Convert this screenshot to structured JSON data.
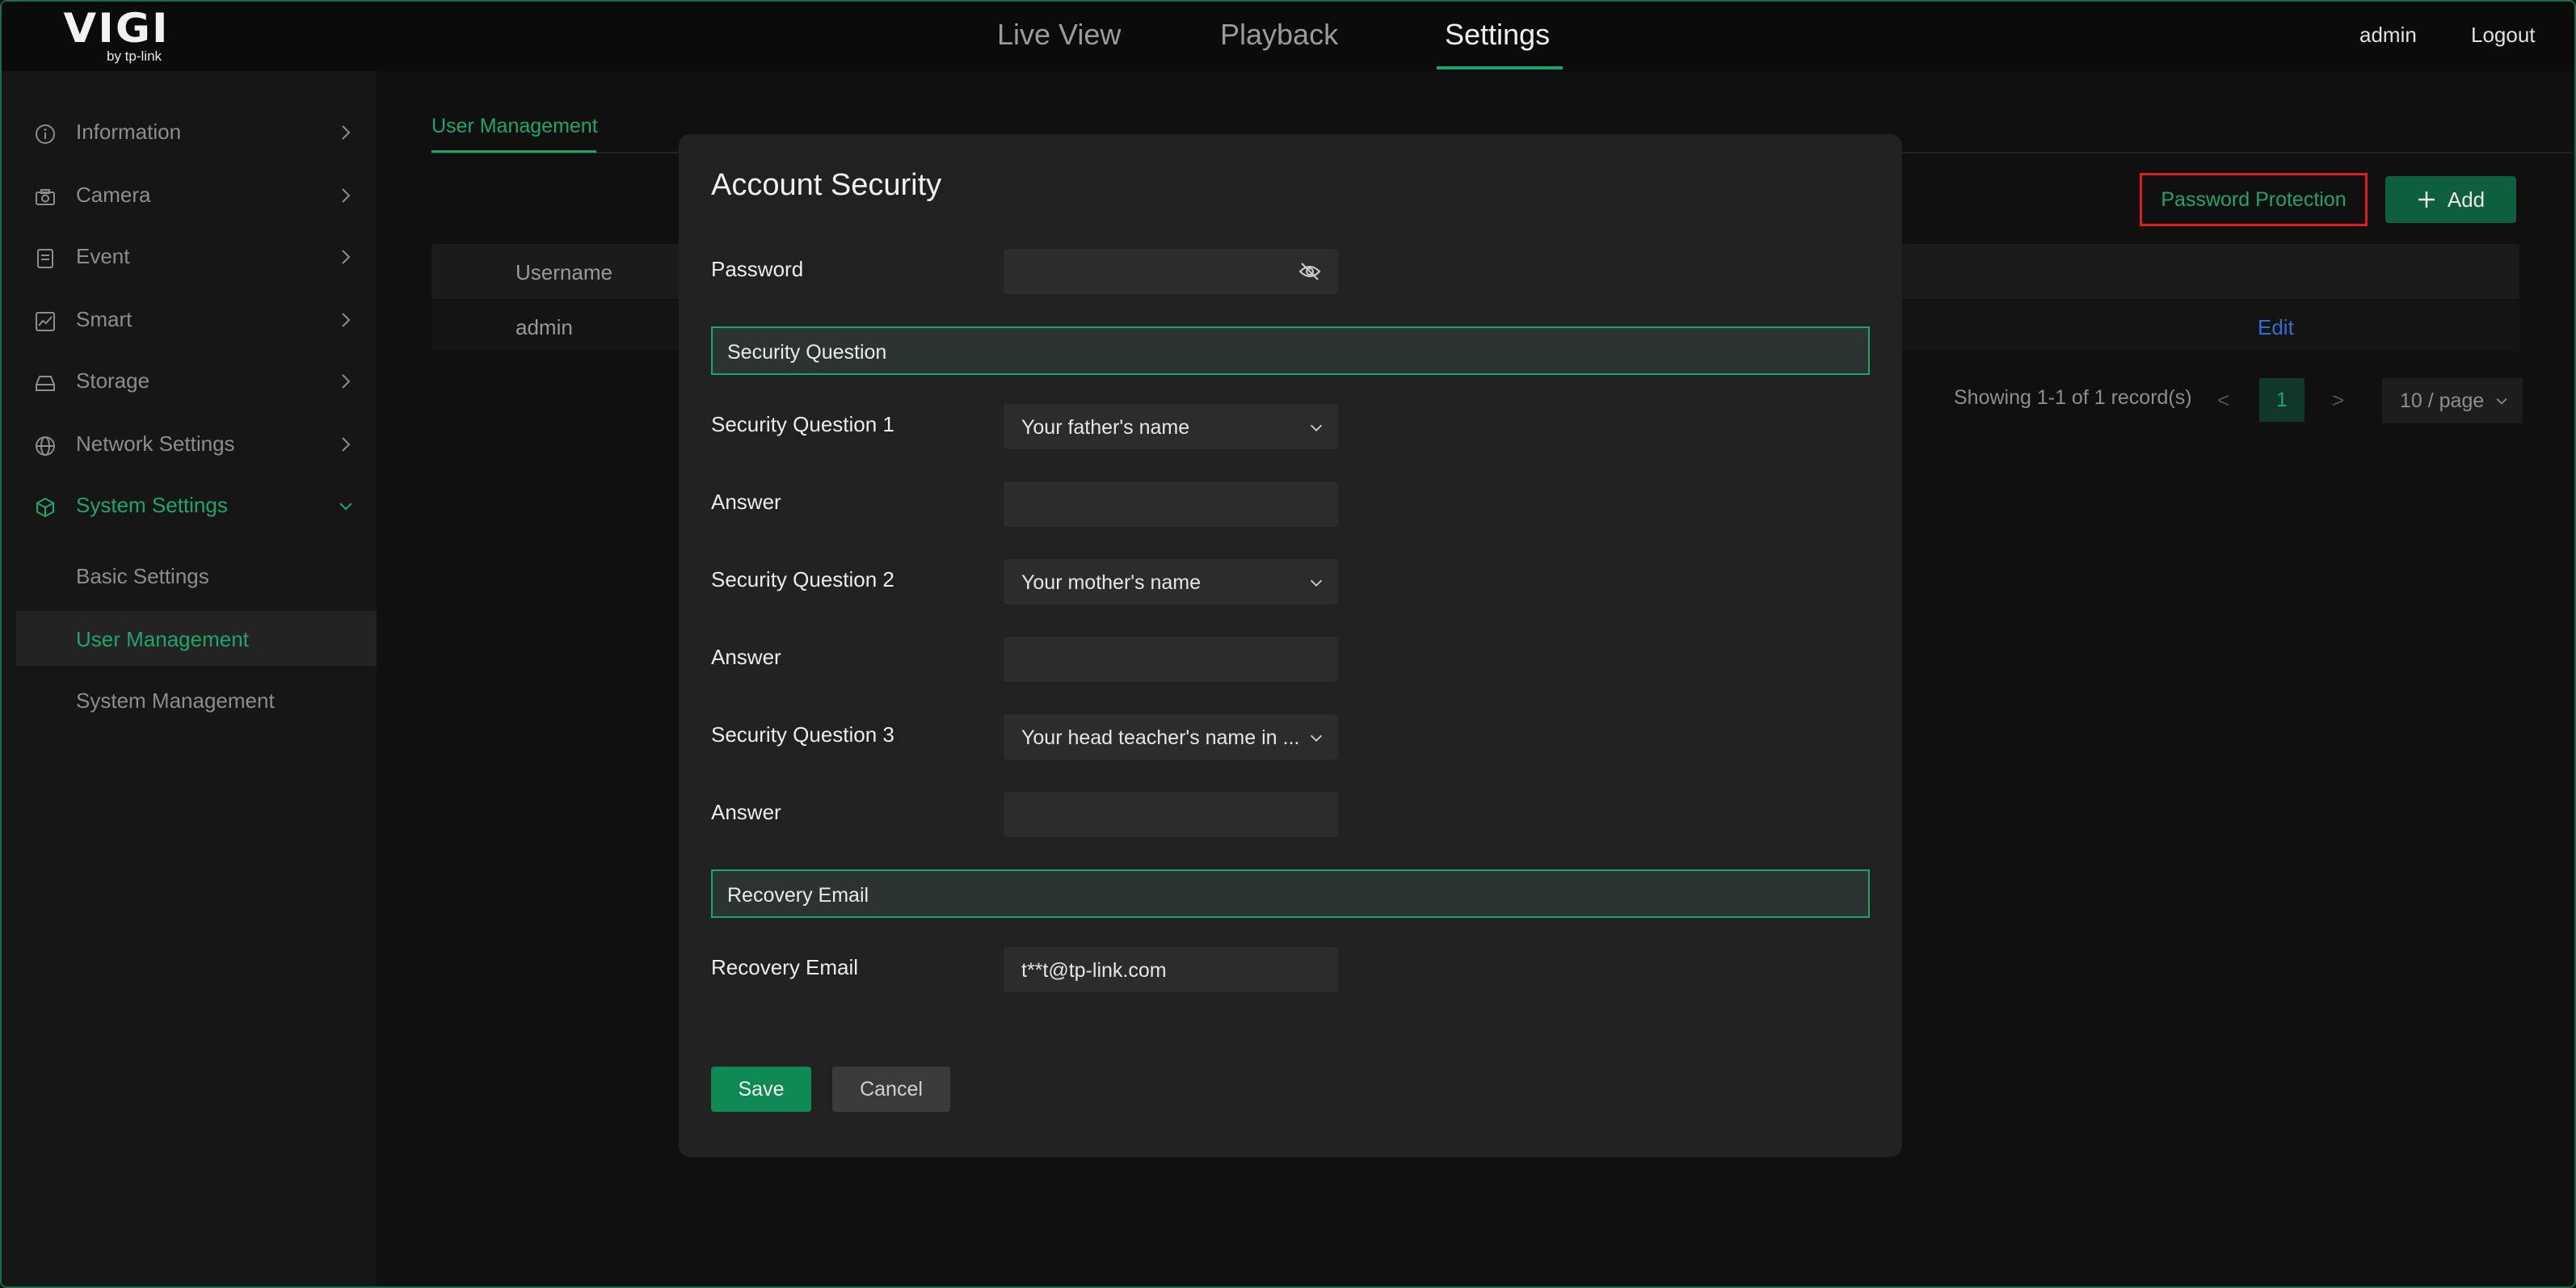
{
  "header": {
    "logo": {
      "brand": "VIGI",
      "sub": "by tp-link"
    },
    "nav": [
      "Live View",
      "Playback",
      "Settings"
    ],
    "user": "admin",
    "logout": "Logout"
  },
  "sidebar": {
    "items": [
      {
        "label": "Information",
        "icon": "info-icon"
      },
      {
        "label": "Camera",
        "icon": "camera-icon"
      },
      {
        "label": "Event",
        "icon": "event-icon"
      },
      {
        "label": "Smart",
        "icon": "chart-icon"
      },
      {
        "label": "Storage",
        "icon": "storage-icon"
      },
      {
        "label": "Network Settings",
        "icon": "globe-icon"
      },
      {
        "label": "System Settings",
        "icon": "cube-icon"
      }
    ],
    "subitems": [
      "Basic Settings",
      "User Management",
      "System Management"
    ]
  },
  "content": {
    "breadcrumb": "User Management",
    "password_protection": "Password Protection",
    "add": "Add",
    "table": {
      "header_username": "Username",
      "row_username": "admin",
      "row_edit": "Edit"
    },
    "pager": {
      "info": "Showing 1-1 of 1 record(s)",
      "page": "1",
      "size": "10 / page"
    }
  },
  "modal": {
    "title": "Account Security",
    "password_label": "Password",
    "password_value": "",
    "section_security": "Security Question",
    "q1_label": "Security Question 1",
    "q1_value": "Your father's name",
    "answer_label": "Answer",
    "q2_label": "Security Question 2",
    "q2_value": "Your mother's name",
    "q3_label": "Security Question 3",
    "q3_value": "Your head teacher's name in ...",
    "section_email": "Recovery Email",
    "email_label": "Recovery Email",
    "email_value": "t**t@tp-link.com",
    "save": "Save",
    "cancel": "Cancel"
  },
  "colors": {
    "accent": "#1fa56a",
    "highlight_border": "#e01c1c",
    "link": "#2f6fd0"
  }
}
